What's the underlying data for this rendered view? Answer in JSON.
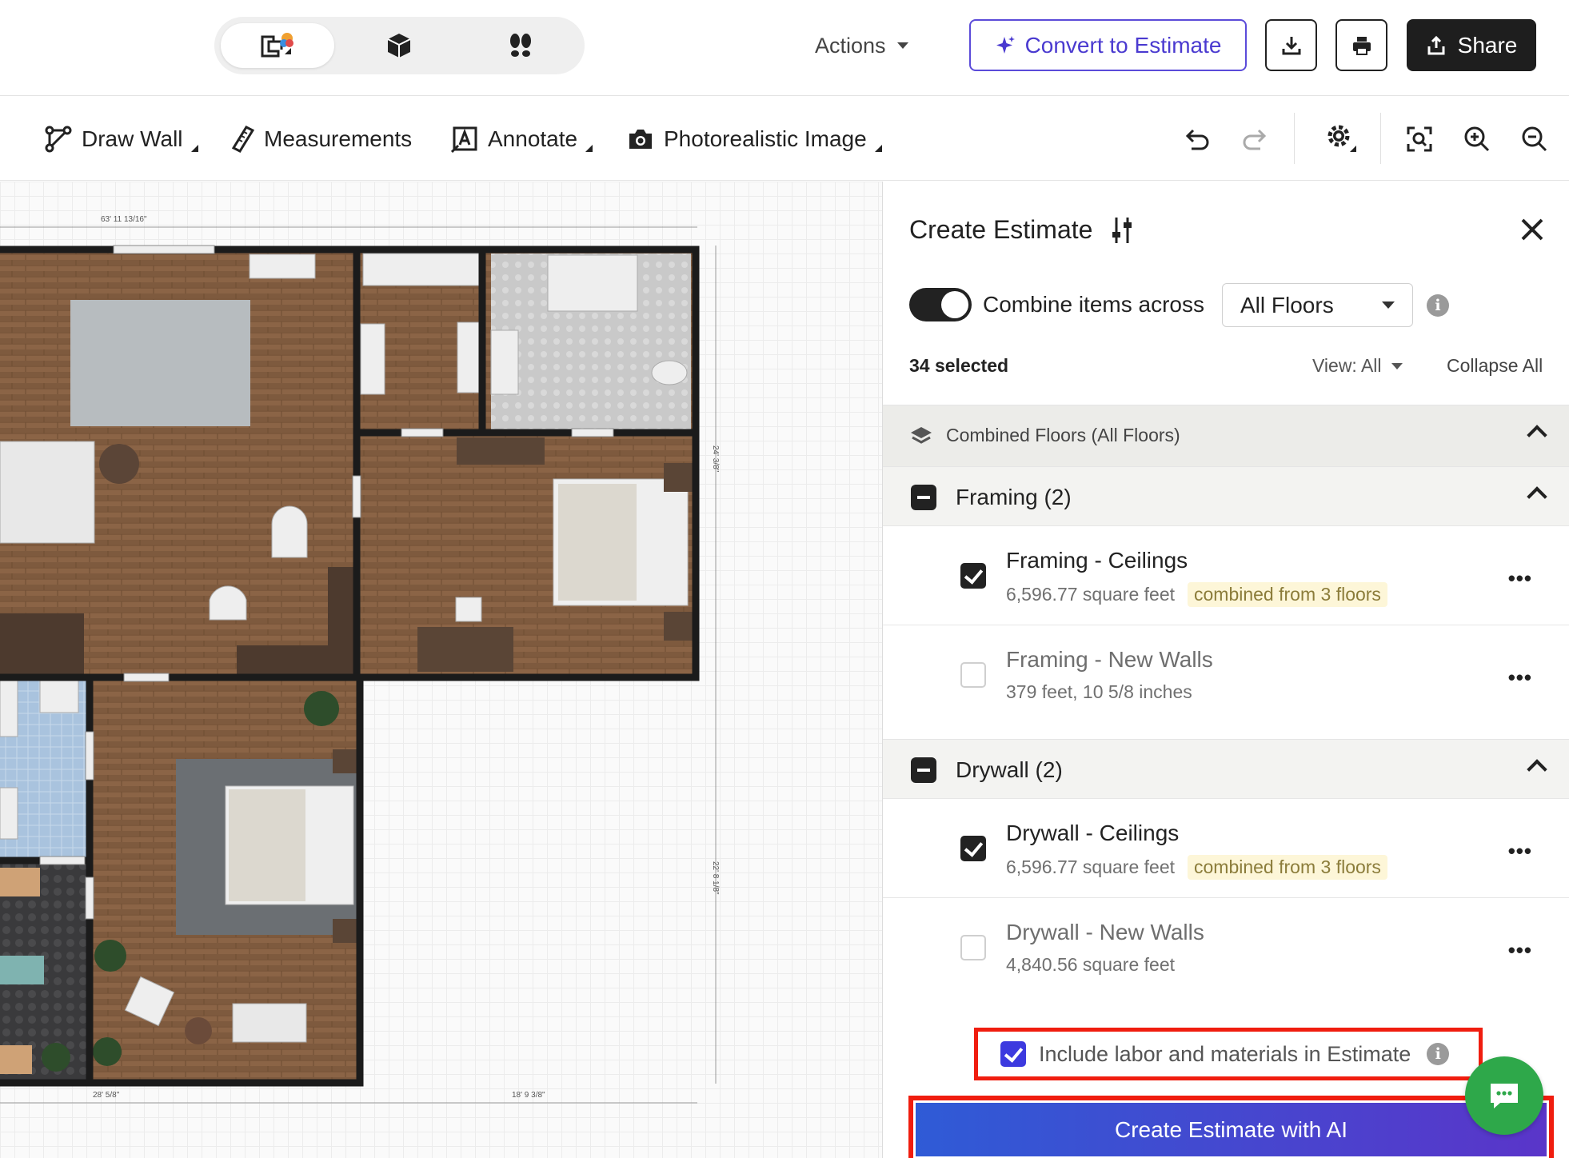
{
  "topbar": {
    "modes": [
      {
        "icon": "floorplan-2d-icon",
        "active": true
      },
      {
        "icon": "3d-box-icon",
        "active": false
      },
      {
        "icon": "walkthrough-footsteps-icon",
        "active": false
      }
    ],
    "actions_label": "Actions",
    "convert_label": "Convert to Estimate",
    "download_icon": "download-icon",
    "print_icon": "print-icon",
    "share_label": "Share"
  },
  "toolbar": {
    "draw_wall": "Draw Wall",
    "measurements": "Measurements",
    "annotate": "Annotate",
    "photo_image": "Photorealistic Image"
  },
  "canvas": {
    "dim_top": "63' 11 13/16\"",
    "dim_right_upper": "24' 3/8\"",
    "dim_right_lower": "22' 8 1/8\"",
    "dim_bottom_left": "28' 5/8\"",
    "dim_bottom_right": "18' 9 3/8\""
  },
  "panel": {
    "title": "Create Estimate",
    "combine_label": "Combine items across",
    "floor_select": "All Floors",
    "selected_count": "34 selected",
    "view_label": "View: All",
    "collapse_label": "Collapse All",
    "combined_header": "Combined Floors (All Floors)",
    "groups": [
      {
        "label": "Framing (2)",
        "items": [
          {
            "name": "Framing - Ceilings",
            "sub": "6,596.77 square feet",
            "tag": "combined from 3 floors",
            "checked": true
          },
          {
            "name": "Framing - New Walls",
            "sub": "379 feet, 10 5/8 inches",
            "tag": "",
            "checked": false
          }
        ]
      },
      {
        "label": "Drywall (2)",
        "items": [
          {
            "name": "Drywall - Ceilings",
            "sub": "6,596.77 square feet",
            "tag": "combined from 3 floors",
            "checked": true
          },
          {
            "name": "Drywall - New Walls",
            "sub": "4,840.56 square feet",
            "tag": "",
            "checked": false
          }
        ]
      }
    ],
    "include_label": "Include labor and materials in Estimate",
    "create_button": "Create Estimate with AI"
  },
  "colors": {
    "accent_purple": "#4a3ad0",
    "highlight_red": "#f01d0f",
    "chat_green": "#2ea84a"
  }
}
